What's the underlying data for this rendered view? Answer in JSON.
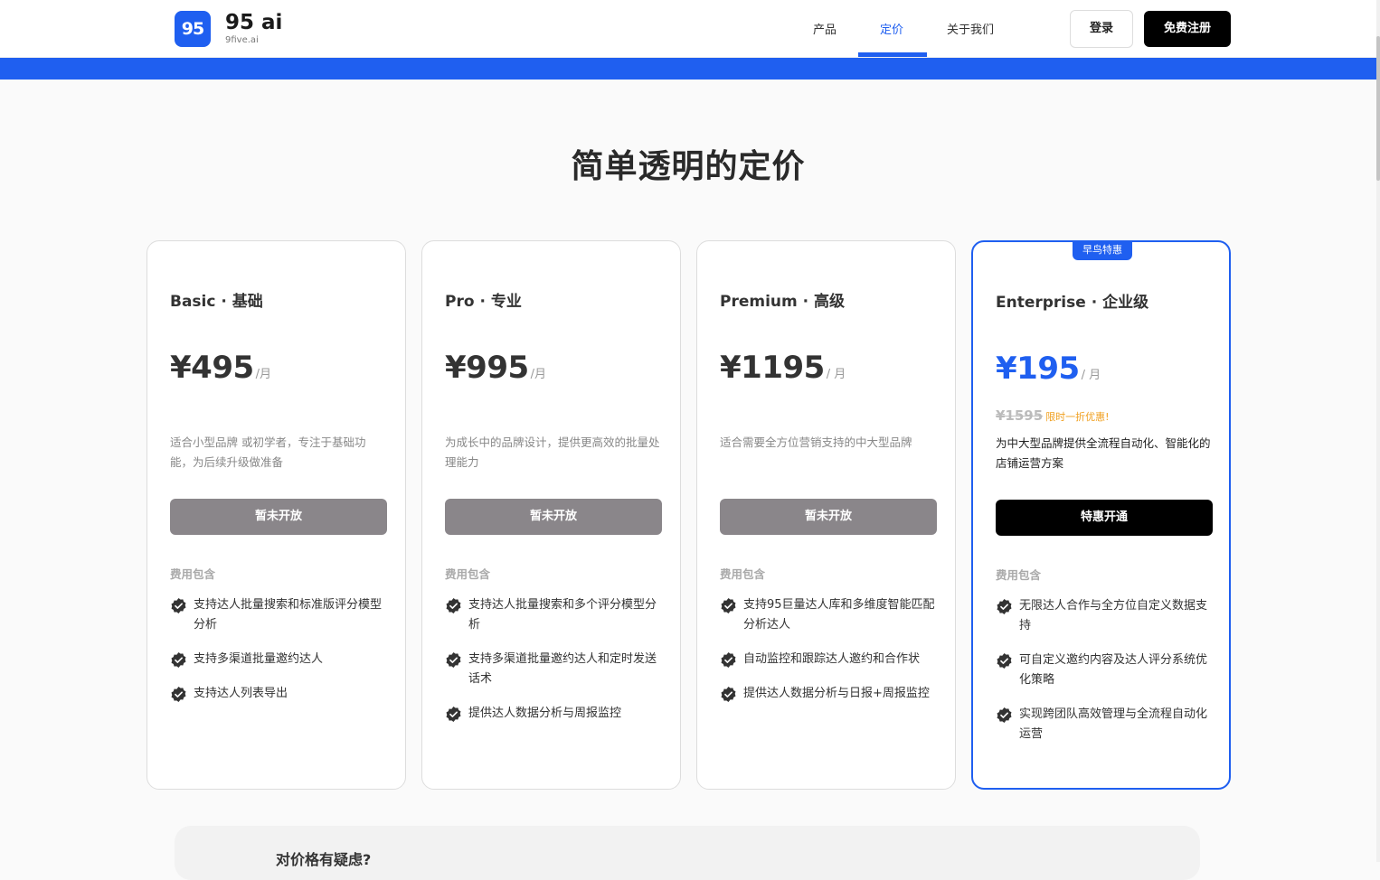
{
  "header": {
    "logo_text": "95",
    "brand_name": "95 ai",
    "brand_domain": "9five.ai",
    "nav": [
      {
        "label": "产品",
        "active": false
      },
      {
        "label": "定价",
        "active": true
      },
      {
        "label": "关于我们",
        "active": false
      }
    ],
    "login_label": "登录",
    "signup_label": "免费注册"
  },
  "colors": {
    "accent": "#1f5ff0",
    "disabled_button": "#8a868a",
    "promo": "#f0a020"
  },
  "main": {
    "title": "简单透明的定价",
    "includes_label": "费用包含",
    "plans": [
      {
        "name": "Basic · 基础",
        "price": "¥495",
        "per": "/月",
        "description": "适合小型品牌 或初学者，专注于基础功能，为后续升级做准备",
        "button": "暂未开放",
        "features": [
          "支持达人批量搜索和标准版评分模型分析",
          "支持多渠道批量邀约达人",
          "支持达人列表导出"
        ]
      },
      {
        "name": "Pro · 专业",
        "price": "¥995",
        "per": "/月",
        "description": "为成长中的品牌设计，提供更高效的批量处理能力",
        "button": "暂未开放",
        "features": [
          "支持达人批量搜索和多个评分模型分析",
          "支持多渠道批量邀约达人和定时发送话术",
          "提供达人数据分析与周报监控"
        ]
      },
      {
        "name": "Premium · 高级",
        "price": "¥1195",
        "per": "/ 月",
        "description": "适合需要全方位营销支持的中大型品牌",
        "button": "暂未开放",
        "features": [
          "支持95巨量达人库和多维度智能匹配分析达人",
          "自动监控和跟踪达人邀约和合作状",
          "提供达人数据分析与日报+周报监控"
        ]
      },
      {
        "name": "Enterprise · 企业级",
        "badge": "早鸟特惠",
        "price": "¥195",
        "per": "/ 月",
        "original_price": "¥1595",
        "promo": "限时一折优惠!",
        "description": "为中大型品牌提供全流程自动化、智能化的店铺运营方案",
        "button": "特惠开通",
        "features": [
          "无限达人合作与全方位自定义数据支持",
          "可自定义邀约内容及达人评分系统优化策略",
          "实现跨团队高效管理与全流程自动化运营"
        ]
      }
    ]
  },
  "faq": {
    "title": "对价格有疑虑?"
  }
}
